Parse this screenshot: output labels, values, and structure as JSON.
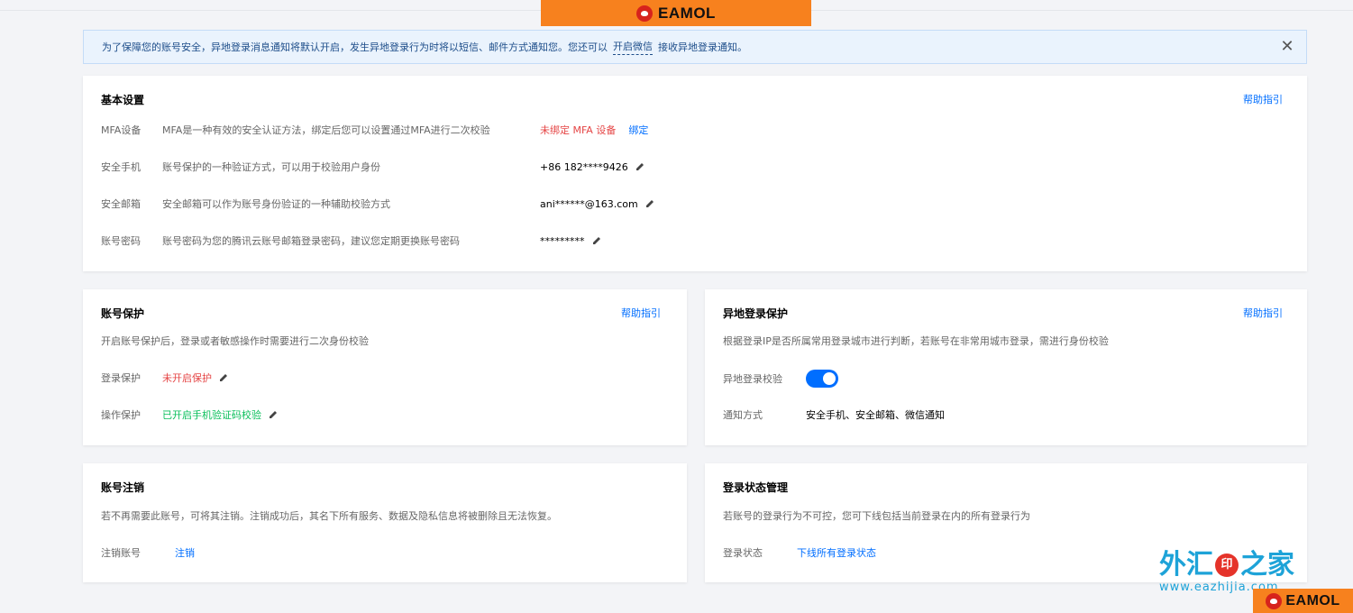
{
  "brand": {
    "logo_text": "EAMOL"
  },
  "notice": {
    "text_before": "为了保障您的账号安全，异地登录消息通知将默认开启，发生异地登录行为时将以短信、邮件方式通知您。您还可以",
    "link": "开启微信",
    "text_after": "接收异地登录通知。",
    "close": "✕"
  },
  "basic": {
    "title": "基本设置",
    "help": "帮助指引",
    "rows": [
      {
        "label": "MFA设备",
        "desc": "MFA是一种有效的安全认证方法，绑定后您可以设置通过MFA进行二次校验",
        "value": "未绑定 MFA 设备",
        "action": "绑定"
      },
      {
        "label": "安全手机",
        "desc": "账号保护的一种验证方式，可以用于校验用户身份",
        "value": "+86 182****9426"
      },
      {
        "label": "安全邮箱",
        "desc": "安全邮箱可以作为账号身份验证的一种辅助校验方式",
        "value": "ani******@163.com"
      },
      {
        "label": "账号密码",
        "desc": "账号密码为您的腾讯云账号邮箱登录密码，建议您定期更换账号密码",
        "value": "*********"
      }
    ]
  },
  "protect": {
    "title": "账号保护",
    "help": "帮助指引",
    "desc": "开启账号保护后，登录或者敏感操作时需要进行二次身份校验",
    "rows": [
      {
        "label": "登录保护",
        "value": "未开启保护"
      },
      {
        "label": "操作保护",
        "value": "已开启手机验证码校验"
      }
    ]
  },
  "remote": {
    "title": "异地登录保护",
    "help": "帮助指引",
    "desc": "根据登录IP是否所属常用登录城市进行判断，若账号在非常用城市登录，需进行身份校验",
    "check_label": "异地登录校验",
    "check_on": true,
    "notify_label": "通知方式",
    "notify_value": "安全手机、安全邮箱、微信通知"
  },
  "cancel": {
    "title": "账号注销",
    "desc": "若不再需要此账号，可将其注销。注销成功后，其名下所有服务、数据及隐私信息将被删除且无法恢复。",
    "label": "注销账号",
    "action": "注销"
  },
  "session": {
    "title": "登录状态管理",
    "desc": "若账号的登录行为不可控，您可下线包括当前登录在内的所有登录行为",
    "label": "登录状态",
    "action": "下线所有登录状态"
  },
  "watermark": {
    "cn_left": "外汇",
    "seal": "印",
    "cn_right": "之家",
    "url": "www.eazhijia.com"
  },
  "colors": {
    "accent": "#006eff",
    "danger": "#e54545",
    "success": "#0abf5b",
    "brand_orange": "#f7811e"
  }
}
